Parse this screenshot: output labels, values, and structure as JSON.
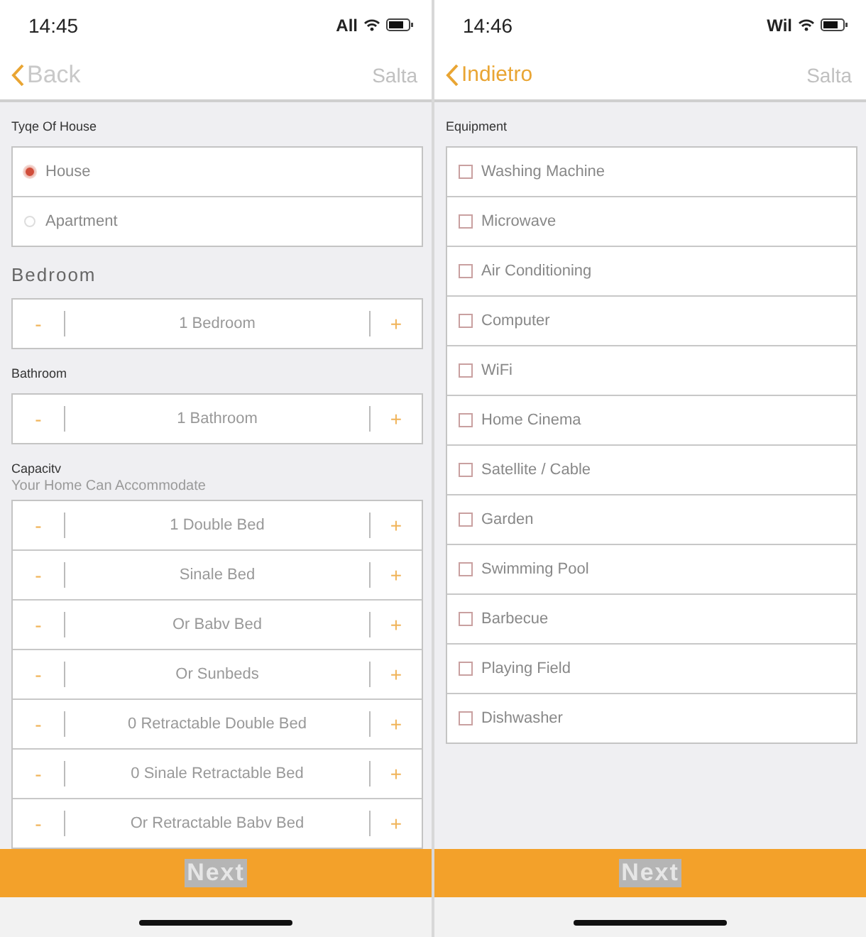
{
  "screens": [
    {
      "status_bar": {
        "time": "14:45",
        "carrier": "All"
      },
      "nav": {
        "back": "Back",
        "skip": "Salta"
      },
      "sections": [
        {
          "kind": "radio",
          "label": "Tyqe Of House",
          "options": [
            {
              "label": "House",
              "selected": true
            },
            {
              "label": "Apartment",
              "selected": false
            }
          ]
        },
        {
          "kind": "stepper",
          "label": "Bedroom",
          "heading": true,
          "rows": [
            {
              "value": "1 Bedroom",
              "minus": "-",
              "plus": "+"
            }
          ]
        },
        {
          "kind": "stepper",
          "label": "Bathroom",
          "heading": false,
          "rows": [
            {
              "value": "1 Bathroom",
              "minus": "-",
              "plus": "+"
            }
          ]
        },
        {
          "kind": "stepper",
          "label": "Capacitv",
          "subtitle": "Your Home Can Accommodate",
          "heading": false,
          "rows": [
            {
              "value": "1 Double Bed",
              "minus": "-",
              "plus": "+"
            },
            {
              "value": "Sinale Bed",
              "minus": "-",
              "plus": "+"
            },
            {
              "value": "Or Babv Bed",
              "minus": "-",
              "plus": "+"
            },
            {
              "value": "Or Sunbeds",
              "minus": "-",
              "plus": "+"
            },
            {
              "value": "0 Retractable Double Bed",
              "minus": "-",
              "plus": "+"
            },
            {
              "value": "0 Sinale Retractable Bed",
              "minus": "-",
              "plus": "+"
            },
            {
              "value": "Or Retractable Babv Bed",
              "minus": "-",
              "plus": "+"
            }
          ]
        }
      ],
      "next": "Next"
    },
    {
      "status_bar": {
        "time": "14:46",
        "carrier": "Wil"
      },
      "nav": {
        "back": "Indietro",
        "skip": "Salta"
      },
      "sections": [
        {
          "kind": "checkbox",
          "label": "Equipment",
          "options": [
            {
              "label": "Washing Machine",
              "checked": false
            },
            {
              "label": "Microwave",
              "checked": false
            },
            {
              "label": "Air Conditioning",
              "checked": false
            },
            {
              "label": "Computer",
              "checked": false
            },
            {
              "label": "WiFi",
              "checked": false
            },
            {
              "label": "Home Cinema",
              "checked": false
            },
            {
              "label": "Satellite / Cable",
              "checked": false
            },
            {
              "label": "Garden",
              "checked": false
            },
            {
              "label": "Swimming Pool",
              "checked": false
            },
            {
              "label": "Barbecue",
              "checked": false
            },
            {
              "label": "Playing Field",
              "checked": false
            },
            {
              "label": "Dishwasher",
              "checked": false
            }
          ]
        }
      ],
      "next": "Next"
    }
  ]
}
